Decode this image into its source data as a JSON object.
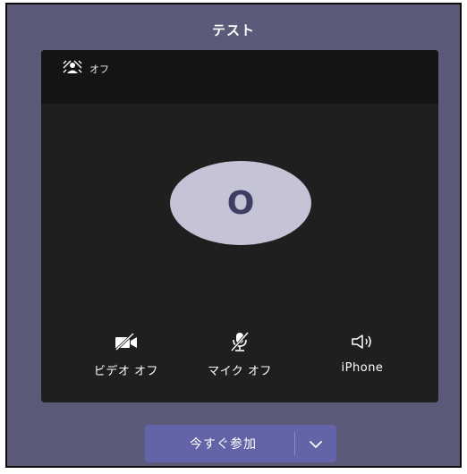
{
  "header": {
    "title": "テスト"
  },
  "preview": {
    "background_toggle_label": "オフ",
    "avatar_initial": "O"
  },
  "controls": {
    "video": {
      "label": "ビデオ オフ",
      "icon": "video-off-icon"
    },
    "mic": {
      "label": "マイク オフ",
      "icon": "mic-off-icon"
    },
    "speaker": {
      "label": "iPhone",
      "icon": "speaker-icon"
    }
  },
  "join": {
    "label": "今すぐ参加",
    "dropdown_icon": "chevron-down-icon"
  },
  "colors": {
    "window_bg": "#5b5a79",
    "preview_bg": "#1f1f1f",
    "avatar_bg": "#c5c3d6",
    "avatar_text": "#3f3d63",
    "accent": "#6264a7"
  }
}
